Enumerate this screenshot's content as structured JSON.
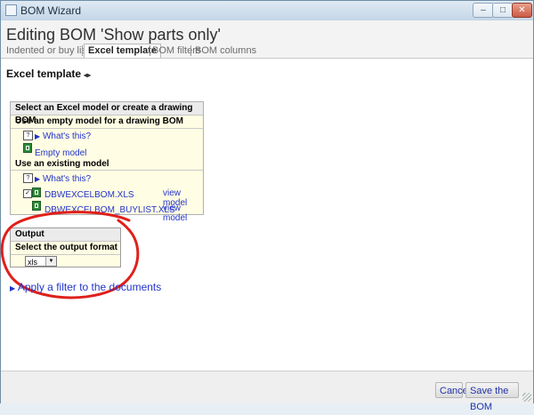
{
  "window": {
    "title": "BOM Wizard",
    "controls": {
      "minimize": "–",
      "maximize": "□",
      "close": "✕"
    }
  },
  "header": {
    "page_title": "Editing BOM 'Show parts only'",
    "tabs": [
      {
        "label": "Indented or buy list?"
      },
      {
        "label": "Excel template",
        "active": true
      },
      {
        "label": "BOM filters"
      },
      {
        "label": "BOM columns"
      }
    ]
  },
  "main": {
    "section_title": "Excel template",
    "excel_panel": {
      "heading": "Select an Excel model or create a drawing BOM",
      "empty_model_heading": "Use an empty model for a drawing BOM",
      "whats_this_1": "What's this?",
      "empty_model_label": "Empty model",
      "existing_model_heading": "Use an existing model",
      "whats_this_2": "What's this?",
      "models": [
        {
          "name": "DBWEXCELBOM.XLS",
          "checked": true,
          "action": "view model"
        },
        {
          "name": "DBWEXCELBOM_BUYLIST.XLS",
          "checked": false,
          "action": "view model"
        }
      ]
    },
    "output_panel": {
      "heading": "Output",
      "subheading": "Select the output format",
      "format_selected": "xls"
    },
    "filter_link": "Apply a filter to the documents"
  },
  "footer": {
    "cancel_label": "Cancel",
    "save_label": "Save the BOM"
  },
  "colors": {
    "panel_background": "#fffde3",
    "link": "#2233cc",
    "annotation": "#e0201a"
  }
}
